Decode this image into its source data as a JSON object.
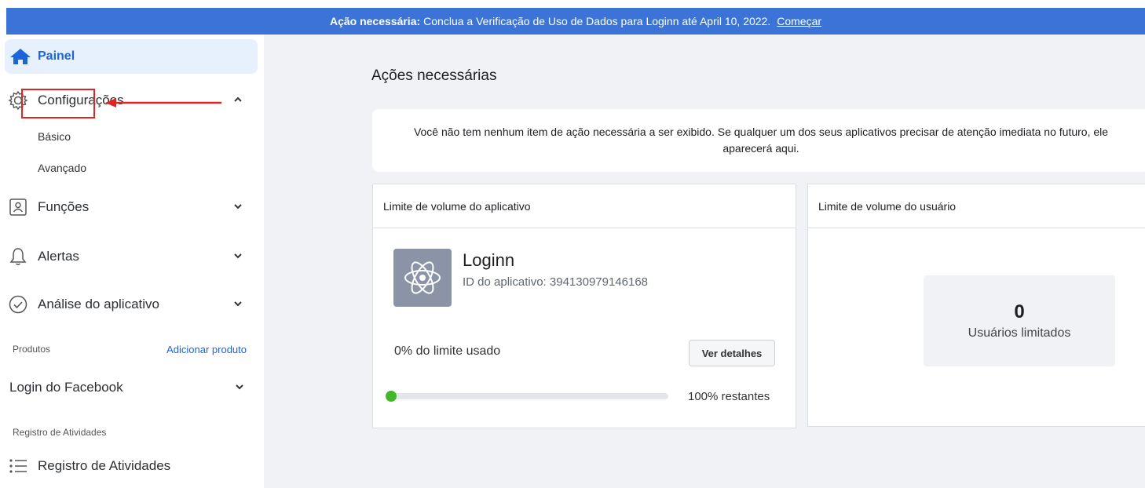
{
  "banner": {
    "prefix": "Ação necessária:",
    "message": "Conclua a Verificação de Uso de Dados para Loginn até April 10, 2022.",
    "link": "Começar"
  },
  "sidebar": {
    "active": "Painel",
    "settings": "Configurações",
    "settings_sub": [
      "Básico",
      "Avançado"
    ],
    "roles": "Funções",
    "alerts": "Alertas",
    "app_review": "Análise do aplicativo",
    "products_label": "Produtos",
    "add_product": "Adicionar produto",
    "facebook_login": "Login do Facebook",
    "activity_label": "Registro de Atividades",
    "activity_item": "Registro de Atividades"
  },
  "main": {
    "title": "Ações necessárias",
    "notice": "Você não tem nenhum item de ação necessária a ser exibido. Se qualquer um dos seus aplicativos precisar de atenção imediata no futuro, ele aparecerá aqui.",
    "app_card": {
      "header": "Limite de volume do aplicativo",
      "app_name": "Loginn",
      "app_id": "ID do aplicativo: 394130979146168",
      "limit_used": "0% do limite usado",
      "details_button": "Ver detalhes",
      "remaining": "100% restantes",
      "used_fraction": 0.0
    },
    "user_card": {
      "header": "Limite de volume do usuário",
      "count": "0",
      "count_label": "Usuários limitados"
    }
  },
  "colors": {
    "accent": "#1a66d9",
    "banner": "#3b73d6",
    "progress": "#42b72a",
    "highlight": "#e02424"
  }
}
